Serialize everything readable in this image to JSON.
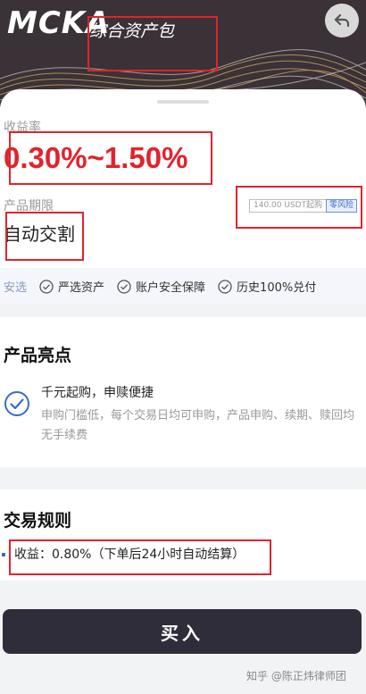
{
  "header": {
    "logo": "MCKA",
    "title": "综合资产包"
  },
  "product": {
    "yield_label": "收益率",
    "yield_value": "0.30%~1.50%",
    "term_label": "产品期限",
    "term_value": "自动交割",
    "min_tag": "140.00 USDT起购",
    "risk_tag": "零风险"
  },
  "assurance": {
    "lead": "安选",
    "items": [
      "严选资产",
      "账户安全保障",
      "历史100%兑付"
    ]
  },
  "highlights": {
    "title": "产品亮点",
    "item_title": "千元起购，申赎便捷",
    "item_desc": "申购门槛低，每个交易日均可申购，产品申购、续期、赎回均无手续费"
  },
  "rules": {
    "title": "交易规则",
    "item": "收益：0.80%（下单后24小时自动结算）"
  },
  "actions": {
    "buy_label": "买入"
  },
  "watermark": "知乎 @陈正炜律师团",
  "colors": {
    "accent_red": "#e0242c",
    "header_bg": "#3a3236",
    "button_bg": "#2f2d3a",
    "link_blue": "#3a6bc9"
  }
}
